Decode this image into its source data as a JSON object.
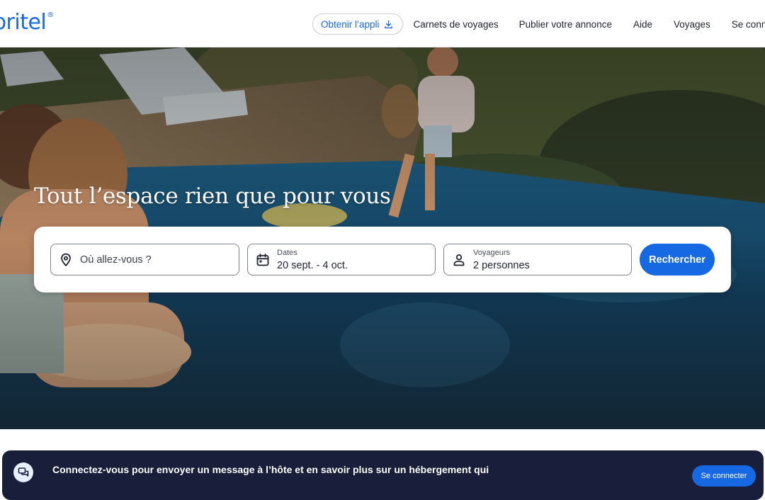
{
  "header": {
    "logo_text": "britel",
    "logo_mark": "®",
    "get_app_label": "Obtenir l’appli",
    "get_app_icon": "download-icon",
    "nav": [
      {
        "label": "Carnets de voyages"
      },
      {
        "label": "Publier votre annonce"
      },
      {
        "label": "Aide"
      },
      {
        "label": "Voyages"
      },
      {
        "label": "Se connecter"
      }
    ]
  },
  "hero": {
    "title": "Tout l’espace rien que pour vous"
  },
  "search": {
    "destination": {
      "placeholder": "Où allez-vous ?",
      "icon": "map-pin-icon"
    },
    "dates": {
      "label": "Dates",
      "value": "20 sept. - 4 oct.",
      "icon": "calendar-icon"
    },
    "travelers": {
      "label": "Voyageurs",
      "value": "2 personnes",
      "icon": "person-icon"
    },
    "submit_label": "Rechercher"
  },
  "signin_banner": {
    "message": "Connectez-vous pour envoyer un message à l’hôte et en savoir plus sur un hébergement qui",
    "button_label": "Se connecter",
    "icon": "chat-bubbles-icon"
  },
  "colors": {
    "brand_blue": "#1668e3",
    "banner_navy": "#191e3b"
  }
}
